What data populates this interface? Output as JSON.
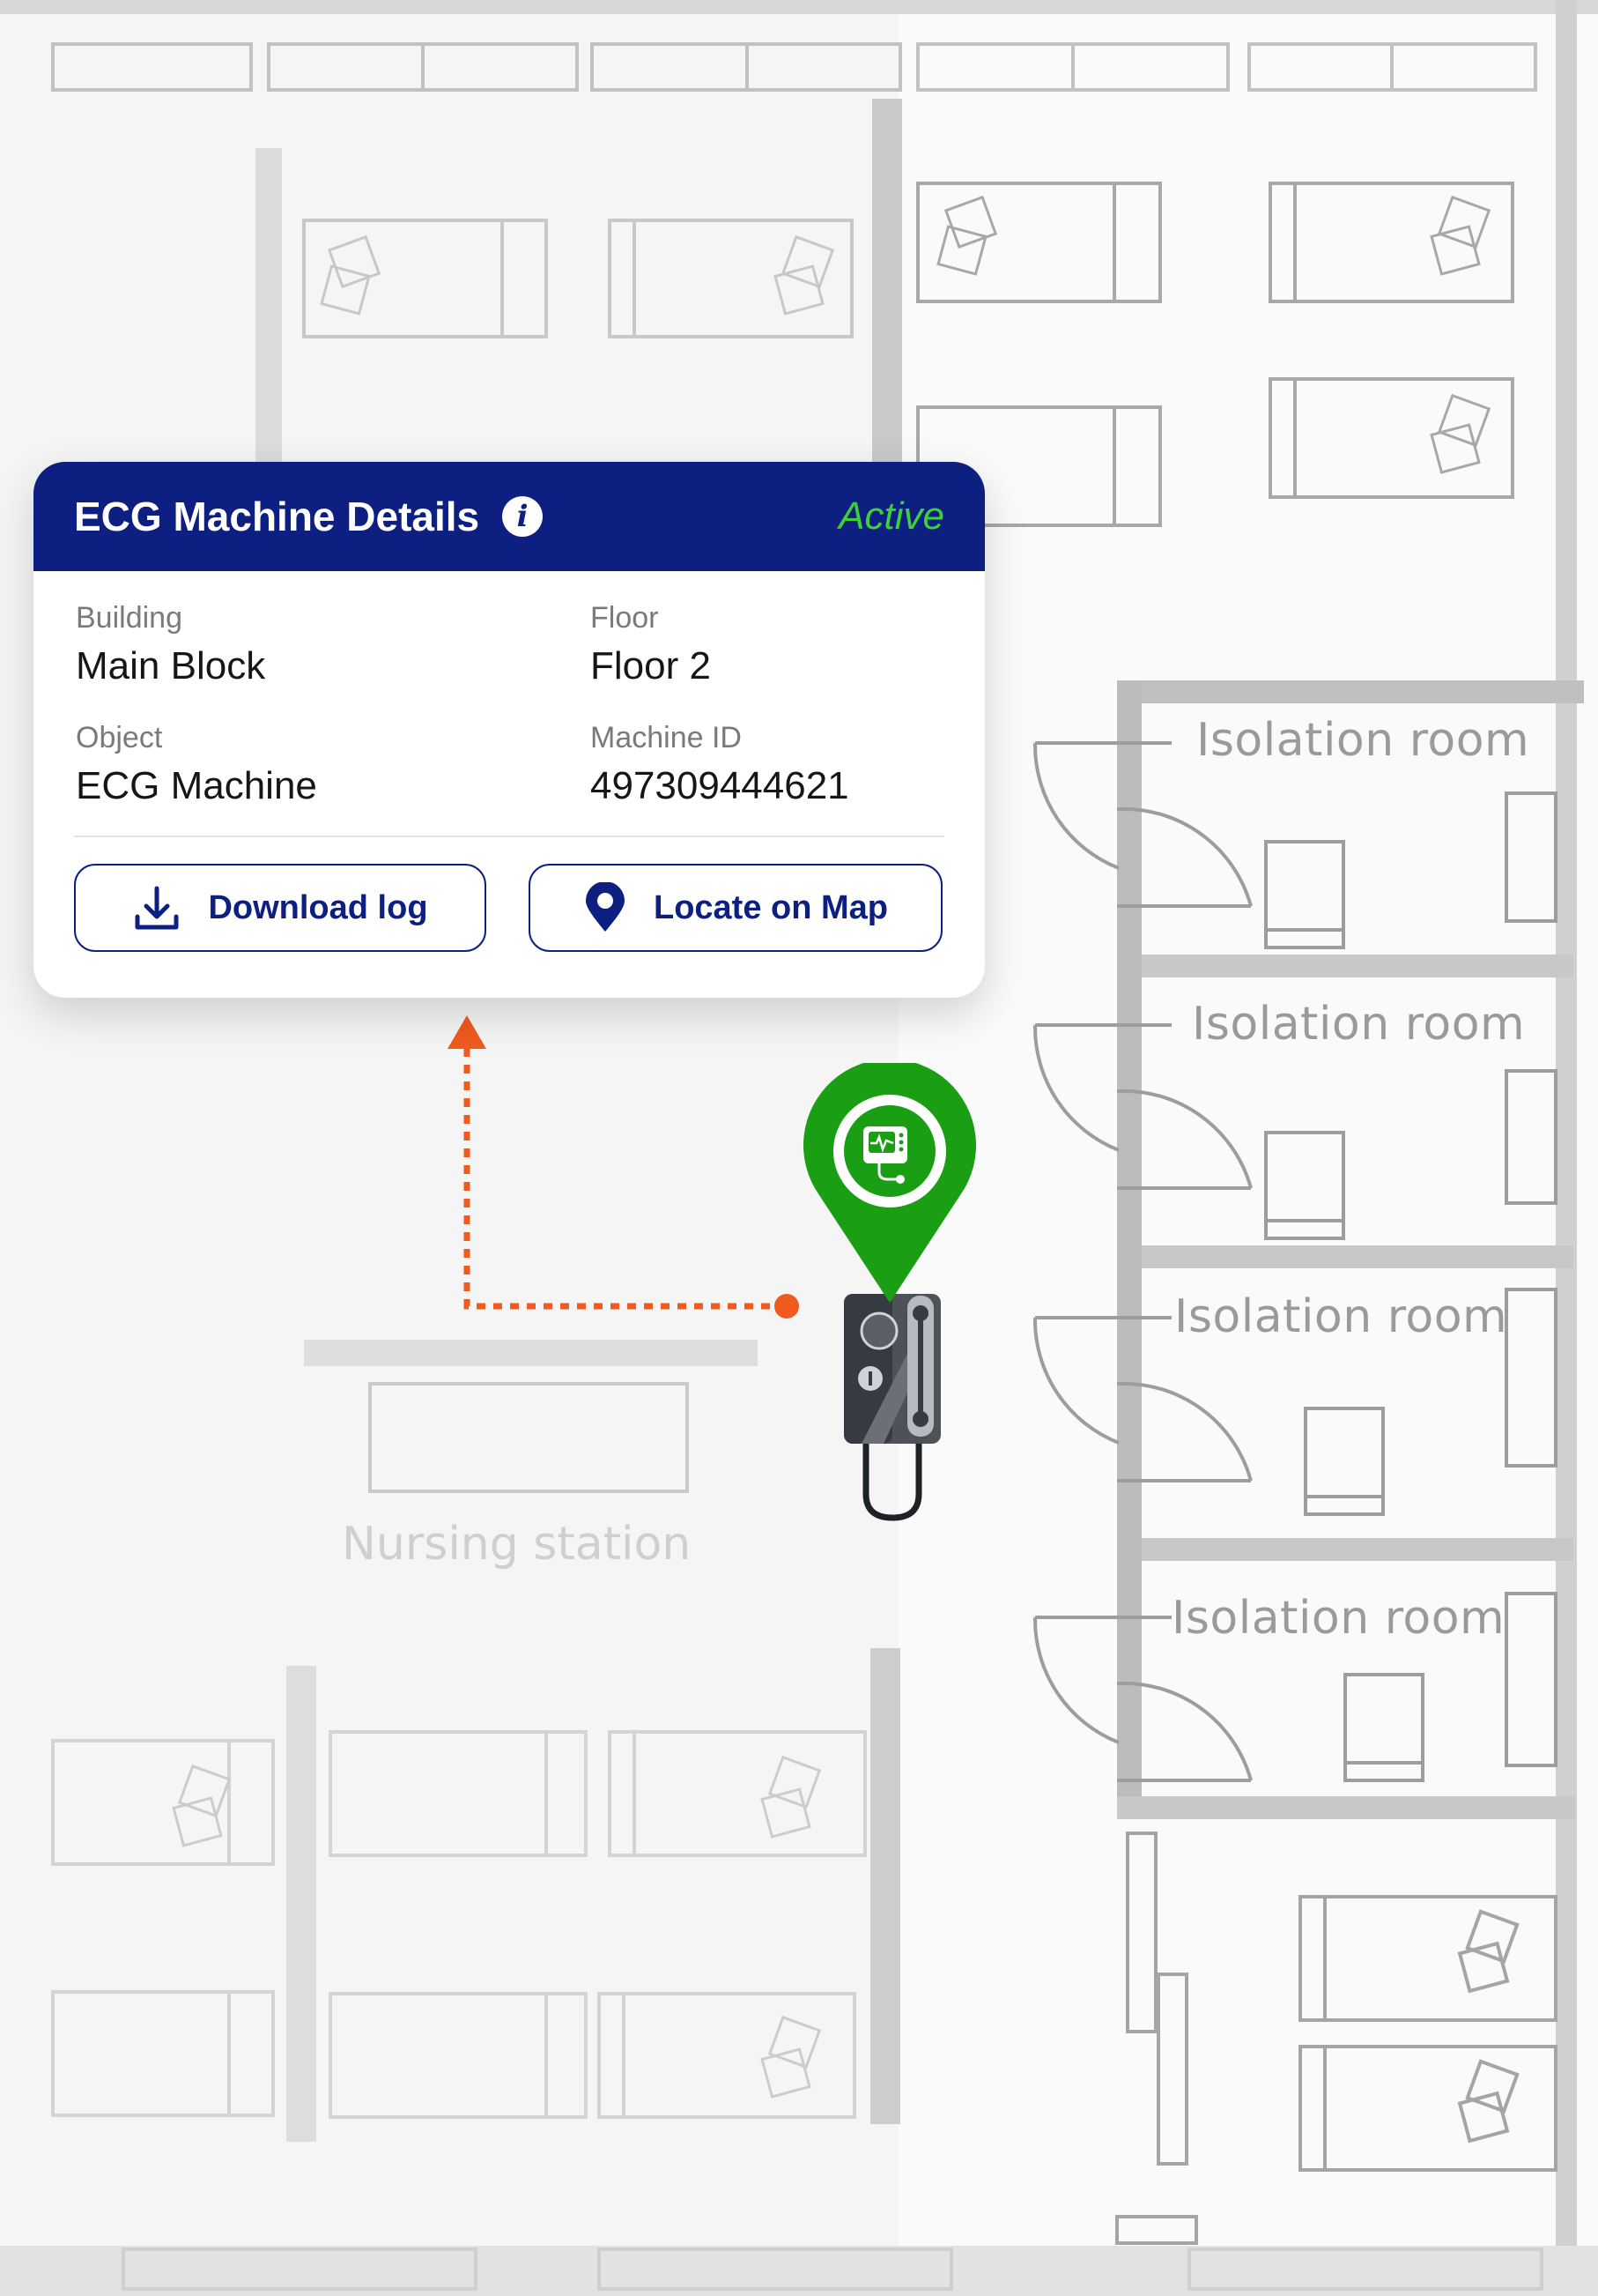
{
  "card": {
    "title": "ECG Machine Details",
    "info_icon": "info-icon",
    "status": "Active",
    "status_color": "#3fcf3a",
    "header_color": "#0d1f80",
    "fields": {
      "building_label": "Building",
      "building_value": "Main Block",
      "floor_label": "Floor",
      "floor_value": "Floor 2",
      "object_label": "Object",
      "object_value": "ECG Machine",
      "machine_id_label": "Machine ID",
      "machine_id_value": "497309444621"
    },
    "buttons": {
      "download_label": "Download log",
      "download_icon": "download-icon",
      "locate_label": "Locate on Map",
      "locate_icon": "location-pin-icon"
    }
  },
  "map": {
    "rooms": [
      "Isolation room",
      "Isolation room",
      "Isolation room",
      "Isolation room"
    ],
    "nursing_station": "Nursing station",
    "marker_icon": "ecg-monitor-icon",
    "marker_color": "#1a9e14",
    "path_color": "#f05a1e"
  }
}
